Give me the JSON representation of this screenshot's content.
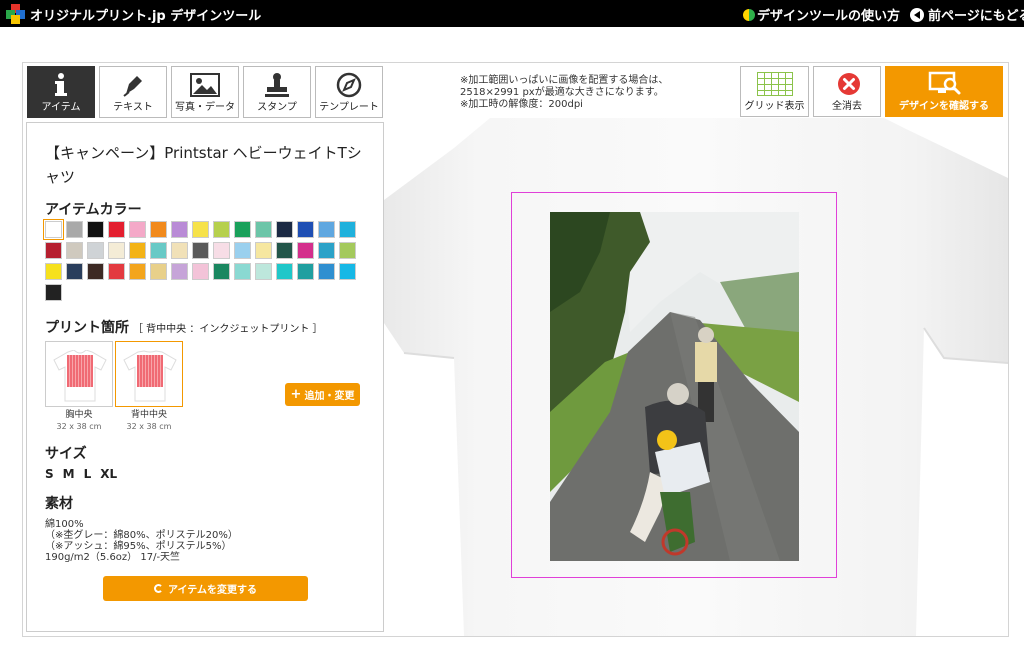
{
  "header": {
    "brand": "オリジナルプリント.jp デザインツール",
    "help_link": "デザインツールの使い方",
    "back_link": "前ページにもどる"
  },
  "tabs": [
    {
      "label": "アイテム",
      "icon": "info-icon",
      "active": true
    },
    {
      "label": "テキスト",
      "icon": "pen-icon",
      "active": false
    },
    {
      "label": "写真・データ",
      "icon": "image-icon",
      "active": false
    },
    {
      "label": "スタンプ",
      "icon": "stamp-icon",
      "active": false
    },
    {
      "label": "テンプレート",
      "icon": "template-icon",
      "active": false
    }
  ],
  "item": {
    "name": "【キャンペーン】Printstar ヘビーウェイトTシャツ",
    "color_heading": "アイテムカラー",
    "colors": [
      "#ffffff",
      "#a9a9a9",
      "#111111",
      "#e31f2f",
      "#f4a9c8",
      "#f18a1d",
      "#b98bd6",
      "#f6e24a",
      "#b6d04d",
      "#1aa15b",
      "#6cc5a8",
      "#1c2a44",
      "#1f4fb4",
      "#5fa7e0",
      "#1fb1dc",
      "#b61f2f",
      "#cfc9be",
      "#cfd3d6",
      "#f4ecd6",
      "#f3b316",
      "#68c9c6",
      "#f1e1b8",
      "#5a5a5a",
      "#f7dde6",
      "#9ad0ee",
      "#f6e7a0",
      "#23564a",
      "#d42f8c",
      "#2ba2c8",
      "#a4c95c",
      "#f6e11d",
      "#2a3e5c",
      "#3d2a24",
      "#e33a40",
      "#f3a51d",
      "#e8d08a",
      "#c6a4d8",
      "#f3c3d8",
      "#1a8760",
      "#8ad9d2",
      "#bde7dc",
      "#1fc7c9",
      "#1f9fa0",
      "#2f8fd0",
      "#16b8e6",
      "#222222"
    ],
    "selected_color": "#ffffff",
    "print_heading": "プリント箇所",
    "print_sub": "［ 背中中央 ：インクジェットプリント ］",
    "positions": [
      {
        "label": "胸中央",
        "dim": "32 x 38 cm",
        "selected": false
      },
      {
        "label": "背中中央",
        "dim": "32 x 38 cm",
        "selected": true
      }
    ],
    "add_button": "追加・変更",
    "size_heading": "サイズ",
    "sizes": [
      "S",
      "M",
      "L",
      "XL"
    ],
    "material_heading": "素材",
    "material_lines": [
      "綿100%",
      "（※杢グレー：綿80%、ポリステル20%）",
      "（※アッシュ：綿95%、ポリステル5%）",
      "190g/m2（5.6oz） 17/-天竺"
    ],
    "change_button": "アイテムを変更する"
  },
  "notes": [
    "※加工範囲いっぱいに画像を配置する場合は、",
    "2518×2991 pxが最適な大きさになります。",
    "※加工時の解像度：200dpi"
  ],
  "toolbar": {
    "grid": "グリッド表示",
    "clear": "全消去",
    "confirm": "デザインを確認する"
  },
  "colors": {
    "accent": "#f39800",
    "print_area_border": "#e040d8",
    "active_tab": "#333333"
  }
}
